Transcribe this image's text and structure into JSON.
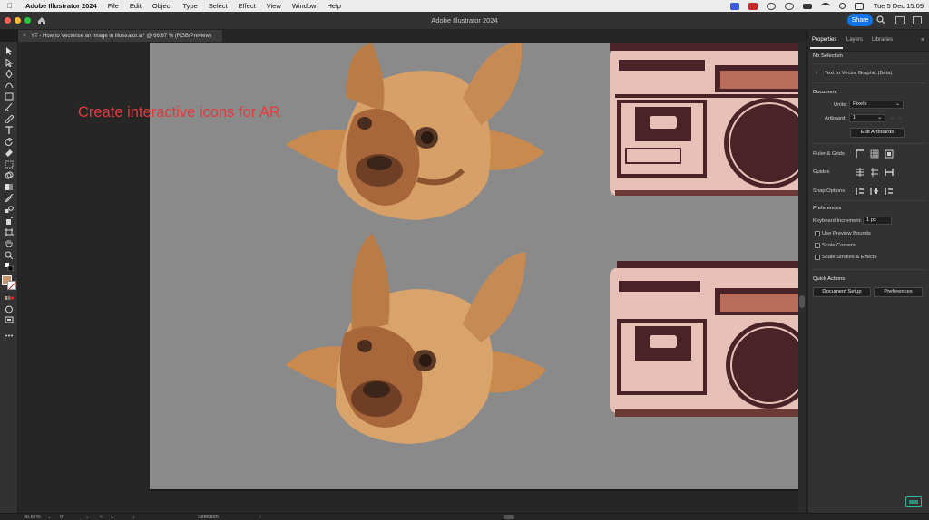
{
  "menubar": {
    "apple_icon": "apple-logo-icon",
    "app_name": "Adobe Illustrator 2024",
    "menus": [
      "File",
      "Edit",
      "Object",
      "Type",
      "Select",
      "Effect",
      "View",
      "Window",
      "Help"
    ],
    "clock": "Tue 5 Dec  15:09"
  },
  "titlebar": {
    "title": "Adobe Illustrator 2024",
    "share_label": "Share"
  },
  "document_tab": {
    "title": "YT - How to Vectorise an Image in Illustrator.ai* @ 66.67 % (RGB/Preview)",
    "close": "×"
  },
  "canvas": {
    "overlay_text": "Create interactive icons for AR"
  },
  "panel": {
    "tabs": [
      "Properties",
      "Layers",
      "Libraries"
    ],
    "menu_icon": "≡",
    "no_selection": "No Selection",
    "text_to_vector": "Text to Vector Graphic (Beta)",
    "document_heading": "Document",
    "units_label": "Units:",
    "units_value": "Pixels",
    "artboard_label": "Artboard:",
    "artboard_value": "1",
    "edit_artboards": "Edit Artboards",
    "ruler_grids": "Ruler & Grids",
    "guides": "Guides",
    "snap_options": "Snap Options",
    "preferences_heading": "Preferences",
    "keyboard_increment_label": "Keyboard Increment:",
    "keyboard_increment_value": "1 px",
    "use_preview_bounds": "Use Preview Bounds",
    "scale_corners": "Scale Corners",
    "scale_strokes": "Scale Strokes & Effects",
    "quick_actions": "Quick Actions",
    "document_setup": "Document Setup",
    "preferences_btn": "Preferences"
  },
  "statusbar": {
    "zoom": "66.67%",
    "rotation": "0°",
    "artboard": "1",
    "tool": "Selection"
  },
  "colors": {
    "accent": "#1473e6",
    "overlay_text": "#e23b3b",
    "artboard_bg": "#8a8a8a",
    "fill_swatch": "#c8956a",
    "radio_pink": "#e7c1b8",
    "radio_maroon": "#4a2328",
    "dog_tan": "#c98a4f"
  }
}
